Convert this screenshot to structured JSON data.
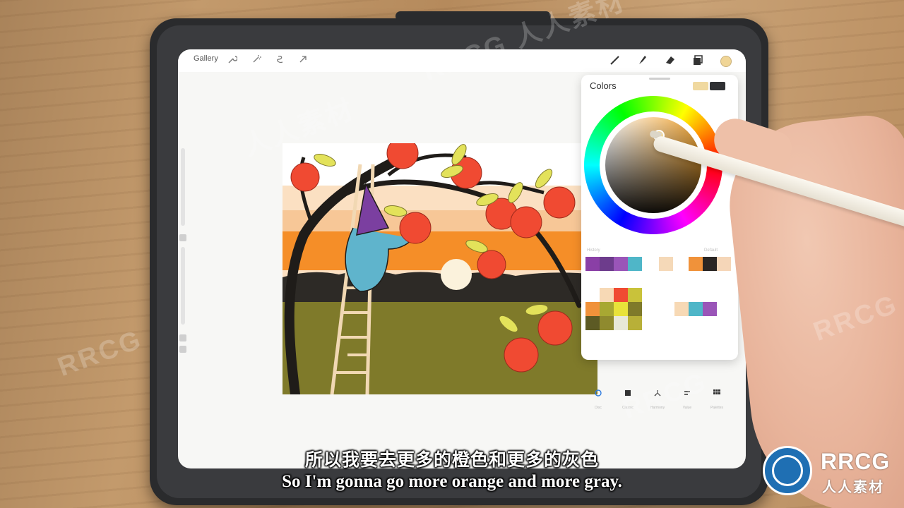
{
  "toolbar": {
    "gallery_label": "Gallery"
  },
  "colors_panel": {
    "title": "Colors",
    "current_color": "#f0d9a0",
    "previous_color": "#2f3033",
    "history_label": "History",
    "default_label": "Default",
    "tabs": [
      "Disc",
      "Classic",
      "Harmony",
      "Value",
      "Palettes"
    ]
  },
  "subtitle": {
    "chinese": "所以我要去更多的橙色和更多的灰色",
    "english": "So I'm gonna go more orange and more gray."
  },
  "logo": {
    "main": "RRCG",
    "sub": "人人素材"
  },
  "watermark": {
    "latin": "RRCG",
    "chinese": "人人素材"
  }
}
